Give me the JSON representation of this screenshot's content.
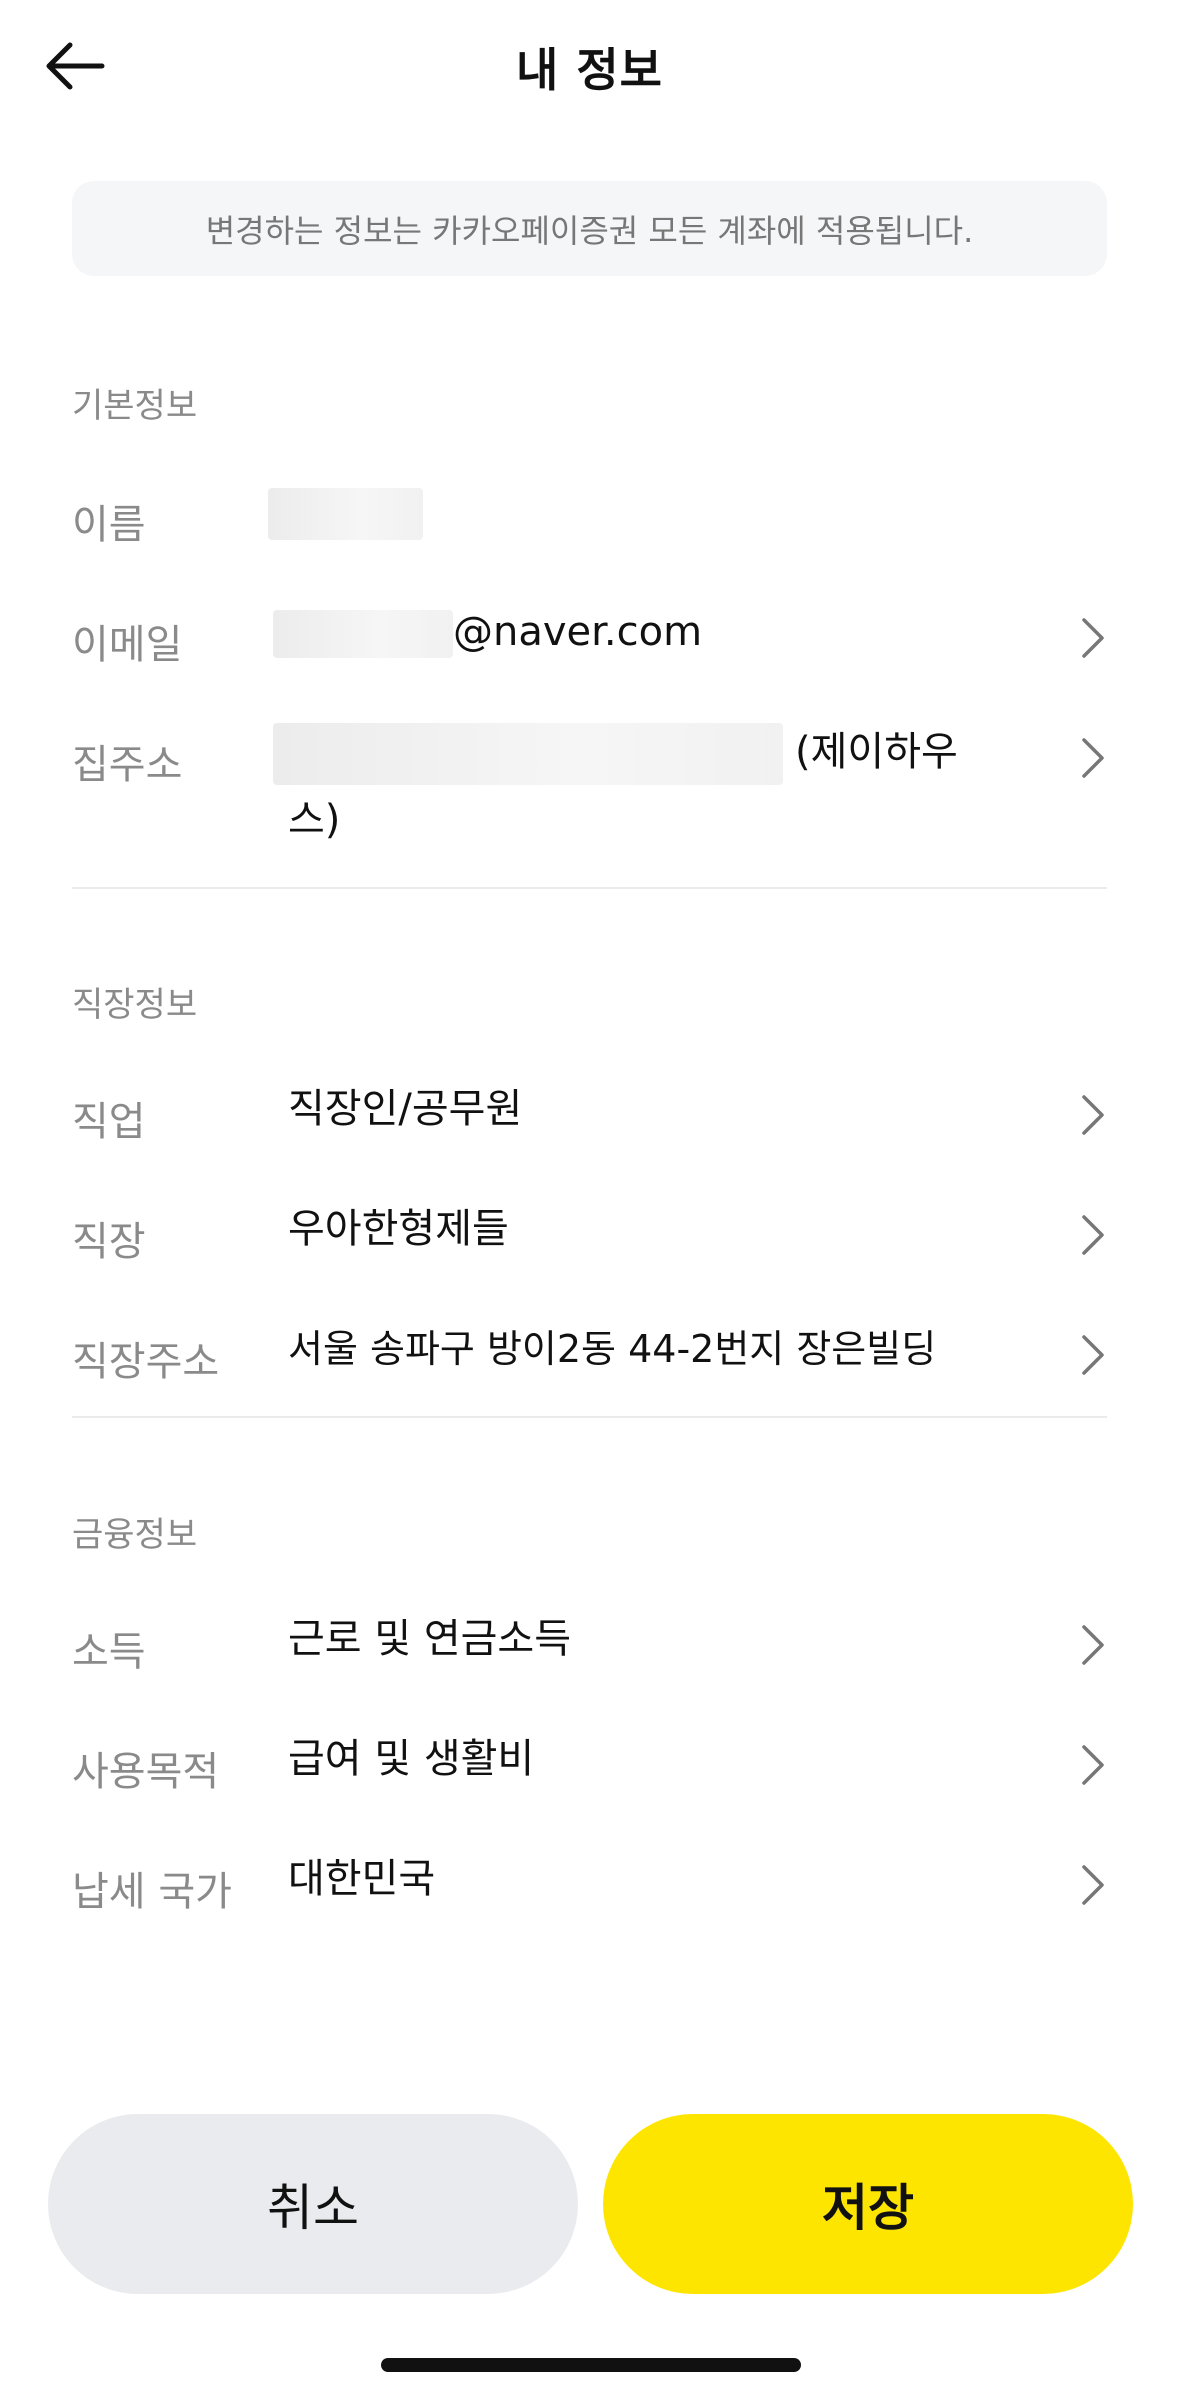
{
  "header": {
    "title": "내 정보",
    "back_icon": "arrow-left-icon"
  },
  "notice": "변경하는 정보는 카카오페이증권 모든 계좌에 적용됩니다.",
  "basic": {
    "title": "기본정보",
    "name_label": "이름",
    "email_label": "이메일",
    "email_domain": "@naver.com",
    "address_label": "집주소",
    "address_suffix": "(제이하우스)"
  },
  "work": {
    "title": "직장정보",
    "job_label": "직업",
    "job_value": "직장인/공무원",
    "company_label": "직장",
    "company_value": "우아한형제들",
    "company_address_label": "직장주소",
    "company_address_value": "서울 송파구 방이2동 44-2번지 장은빌딩"
  },
  "finance": {
    "title": "금융정보",
    "income_label": "소득",
    "income_value": "근로 및 연금소득",
    "purpose_label": "사용목적",
    "purpose_value": "급여 및 생활비",
    "tax_country_label": "납세 국가",
    "tax_country_value": "대한민국"
  },
  "buttons": {
    "cancel": "취소",
    "save": "저장"
  },
  "colors": {
    "accent": "#fee500",
    "cancel_bg": "#e9ebee",
    "notice_bg": "#f5f6f8"
  }
}
